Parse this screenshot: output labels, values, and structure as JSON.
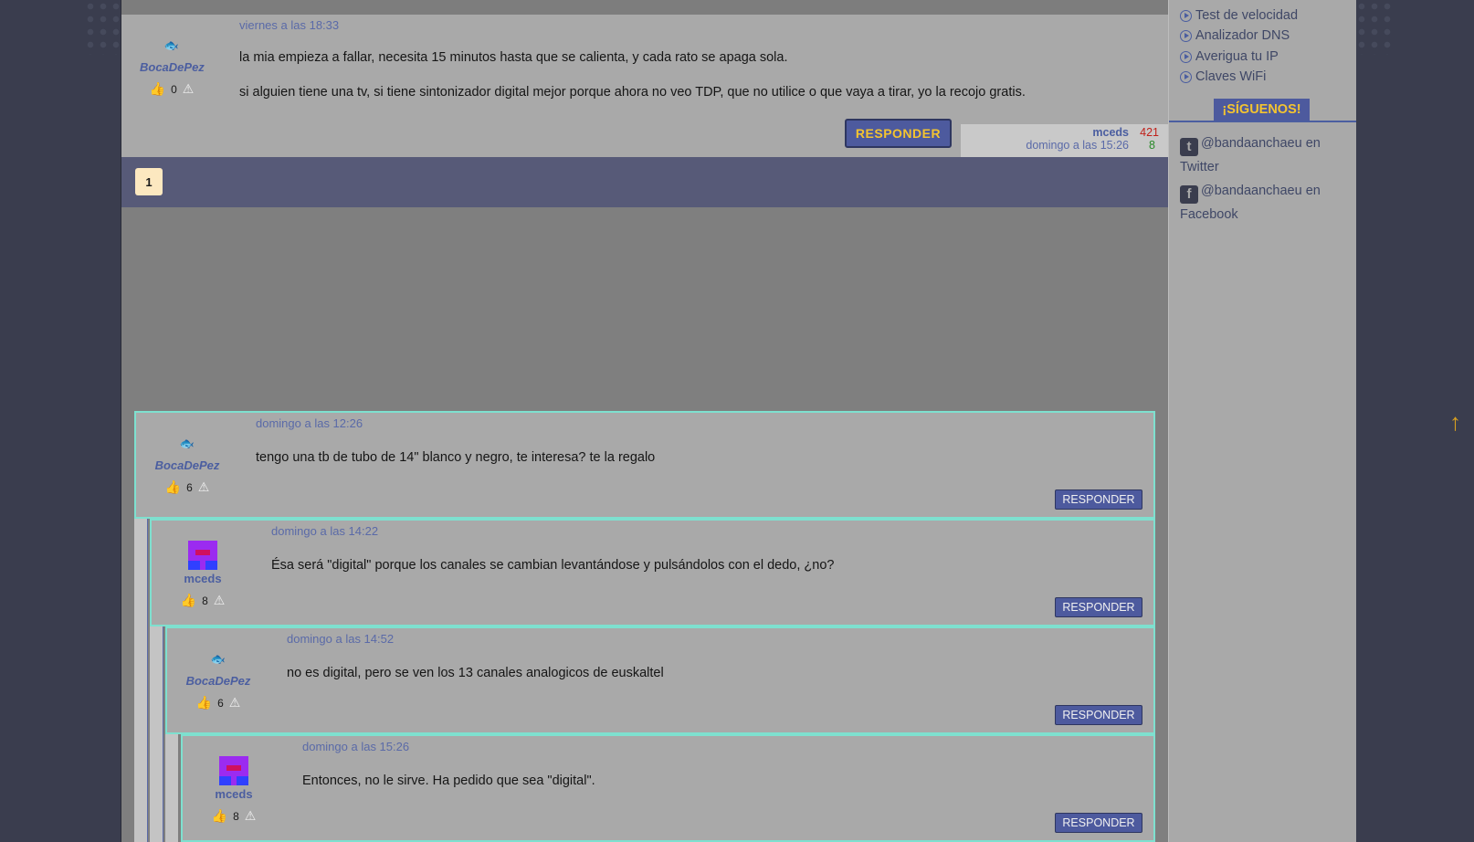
{
  "top_post": {
    "date": "viernes a las 18:33",
    "author": "BocaDePez",
    "votes": "0",
    "paragraph1": "la mia empieza a fallar, necesita 15 minutos hasta que se calienta, y cada rato se apaga sola.",
    "paragraph2": "si alguien tiene una tv, si tiene sintonizador digital mejor porque ahora no veo TDP, que no utilice o que vaya a tirar, yo la recojo gratis.",
    "reply_label": "RESPONDER",
    "last_reply": {
      "user": "mceds",
      "date": "domingo a las 15:26",
      "count_red": "421",
      "count_green": "8"
    }
  },
  "pagination": {
    "current_page": "1"
  },
  "replies": [
    {
      "date": "domingo a las 12:26",
      "author": "BocaDePez",
      "votes": "6",
      "text": "tengo una tb de tubo de 14\" blanco y negro, te interesa? te la regalo",
      "reply_label": "RESPONDER",
      "avatar": "fish-icon"
    },
    {
      "date": "domingo a las 14:22",
      "author": "mceds",
      "votes": "8",
      "text": "Ésa será \"digital\" porque los canales se cambian levantándose y pulsándolos con el dedo, ¿no?",
      "reply_label": "RESPONDER",
      "avatar": "identicon"
    },
    {
      "date": "domingo a las 14:52",
      "author": "BocaDePez",
      "votes": "6",
      "text": "no es digital, pero se ven los 13 canales analogicos de euskaltel",
      "reply_label": "RESPONDER",
      "avatar": "fish-icon"
    },
    {
      "date": "domingo a las 15:26",
      "author": "mceds",
      "votes": "8",
      "text": "Entonces, no le sirve. Ha pedido que sea \"digital\".",
      "reply_label": "RESPONDER",
      "avatar": "identicon"
    }
  ],
  "sidebar": {
    "links": [
      "Test de velocidad",
      "Analizador DNS",
      "Averigua tu IP",
      "Claves WiFi"
    ],
    "follow_title": "¡SÍGUENOS!",
    "twitter": "@bandaanchaeu en Twitter",
    "facebook": "@bandaanchaeu en Facebook"
  },
  "colors": {
    "accent": "#4d5a9e",
    "button_text": "#f4c430",
    "highlight_border": "#7ee0cf",
    "author_link": "#4b5ea0"
  }
}
